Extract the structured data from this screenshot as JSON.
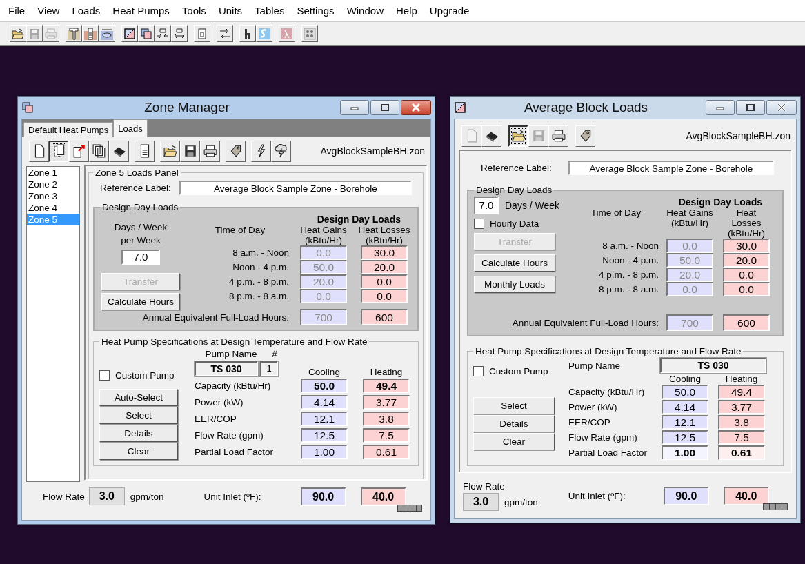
{
  "menu_bar": [
    "File",
    "View",
    "Loads",
    "Heat Pumps",
    "Tools",
    "Units",
    "Tables",
    "Settings",
    "Window",
    "Help",
    "Upgrade"
  ],
  "toolbar": [
    [
      {
        "pressed": false,
        "disabled": false
      },
      {
        "pressed": false,
        "disabled": true
      },
      {
        "pressed": false,
        "disabled": true
      }
    ],
    [
      {
        "pressed": false,
        "disabled": false
      },
      {
        "pressed": false,
        "disabled": false
      },
      {
        "pressed": false,
        "disabled": false
      }
    ],
    [
      {
        "pressed": false,
        "disabled": false
      },
      {
        "pressed": false,
        "disabled": false
      },
      {
        "pressed": false,
        "disabled": false
      },
      {
        "pressed": false,
        "disabled": false
      }
    ],
    [
      {
        "pressed": false,
        "disabled": false
      }
    ],
    [
      {
        "pressed": false,
        "disabled": false
      }
    ],
    [
      {
        "pressed": false,
        "disabled": false
      },
      {
        "pressed": false,
        "disabled": false
      }
    ],
    [
      {
        "pressed": false,
        "disabled": false
      }
    ],
    [
      {
        "pressed": false,
        "disabled": false
      }
    ]
  ],
  "zone_manager": {
    "title": "Zone Manager",
    "active": true,
    "tabs": [
      {
        "label": "Default Heat Pumps",
        "selected": false
      },
      {
        "label": "Loads",
        "selected": true
      }
    ],
    "toolbar": [
      [
        {
          "pressed": false,
          "disabled": false
        },
        {
          "pressed": true,
          "disabled": false
        },
        {
          "pressed": false,
          "disabled": false
        },
        {
          "pressed": false,
          "disabled": false
        },
        {
          "pressed": false,
          "disabled": false
        }
      ],
      [
        {
          "pressed": false,
          "disabled": false
        }
      ],
      [
        {
          "pressed": false,
          "disabled": false
        },
        {
          "pressed": false,
          "disabled": false
        },
        {
          "pressed": false,
          "disabled": false
        }
      ],
      [
        {
          "pressed": false,
          "disabled": false
        }
      ],
      [
        {
          "pressed": false,
          "disabled": false
        },
        {
          "pressed": false,
          "disabled": false
        }
      ]
    ],
    "file_name": "AvgBlockSampleBH.zon",
    "zones": [
      {
        "label": "Zone 1",
        "selected": false
      },
      {
        "label": "Zone 2",
        "selected": false
      },
      {
        "label": "Zone 3",
        "selected": false
      },
      {
        "label": "Zone 4",
        "selected": false
      },
      {
        "label": "Zone 5",
        "selected": true
      }
    ],
    "panel_title": "Zone 5 Loads Panel",
    "reference": {
      "label": "Reference Label:",
      "value": "Average Block Sample Zone - Borehole"
    },
    "design_day": {
      "group_title": "Design Day Loads",
      "days_label": "Days / Week per Week",
      "days_value": "7.0",
      "buttons": [
        {
          "label": "Transfer",
          "disabled": true
        },
        {
          "label": "Calculate Hours",
          "disabled": false
        }
      ],
      "table_title": "Design Day Loads",
      "time_header": "Time of Day",
      "columns": [
        {
          "label": "Heat Gains (kBtu/Hr)",
          "color": "#e0e0fc",
          "disabled": true
        },
        {
          "label": "Heat Losses (kBtu/Hr)",
          "color": "#fcd2d2",
          "disabled": false
        }
      ],
      "rows": [
        {
          "time": "8 a.m. - Noon",
          "values": [
            "0.0",
            "30.0"
          ]
        },
        {
          "time": "Noon - 4 p.m.",
          "values": [
            "50.0",
            "20.0"
          ]
        },
        {
          "time": "4 p.m. - 8 p.m.",
          "values": [
            "20.0",
            "0.0"
          ]
        },
        {
          "time": "8 p.m. - 8 a.m.",
          "values": [
            "0.0",
            "0.0"
          ]
        }
      ],
      "annual_label": "Annual Equivalent Full-Load Hours:",
      "annual_values": [
        "700",
        "600"
      ]
    },
    "heat_pump": {
      "group_title": "Heat Pump Specifications at Design Temperature and Flow Rate",
      "custom": {
        "label": "Custom Pump",
        "checked": false
      },
      "pump_name_header": "Pump Name",
      "count_header": "#",
      "pump_name": "TS 030",
      "count": "1",
      "buttons": [
        "Auto-Select",
        "Select",
        "Details",
        "Clear"
      ],
      "columns": [
        {
          "label": "Cooling",
          "color": "#e0e0fc"
        },
        {
          "label": "Heating",
          "color": "#fcd2d2"
        }
      ],
      "rows": [
        {
          "label": "Capacity (kBtu/Hr)",
          "values": [
            "50.0",
            "49.4"
          ],
          "bold": true,
          "pale": false
        },
        {
          "label": "Power (kW)",
          "values": [
            "4.14",
            "3.77"
          ],
          "bold": false,
          "pale": false
        },
        {
          "label": "EER/COP",
          "values": [
            "12.1",
            "3.8"
          ],
          "bold": false,
          "pale": false
        },
        {
          "label": "Flow Rate (gpm)",
          "values": [
            "12.5",
            "7.5"
          ],
          "bold": false,
          "pale": false
        },
        {
          "label": "Partial Load Factor",
          "values": [
            "1.00",
            "0.61"
          ],
          "bold": false,
          "pale": false
        }
      ]
    },
    "flow_rate": {
      "label": "Flow Rate",
      "value": "3.0",
      "unit": "gpm/ton"
    },
    "unit_inlet": {
      "label": "Unit Inlet (ºF):",
      "values": [
        "90.0",
        "40.0"
      ]
    }
  },
  "average_block_loads": {
    "title": "Average Block Loads",
    "active": false,
    "toolbar": [
      [
        {
          "pressed": false,
          "disabled": true
        },
        {
          "pressed": false,
          "disabled": false
        }
      ],
      [
        {
          "pressed": true,
          "disabled": false
        },
        {
          "pressed": false,
          "disabled": true
        },
        {
          "pressed": false,
          "disabled": false
        }
      ],
      [
        {
          "pressed": false,
          "disabled": false
        }
      ]
    ],
    "file_name": "AvgBlockSampleBH.zon",
    "reference": {
      "label": "Reference Label:",
      "value": "Average Block Sample Zone - Borehole"
    },
    "design_day": {
      "group_title": "Design Day Loads",
      "days_label": "Days / Week",
      "days_value": "7.0",
      "hourly": {
        "label": "Hourly Data",
        "checked": false
      },
      "buttons": [
        {
          "label": "Transfer",
          "disabled": true
        },
        {
          "label": "Calculate Hours",
          "disabled": false
        },
        {
          "label": "Monthly Loads",
          "disabled": false
        }
      ],
      "table_title": "Design Day Loads",
      "time_header": "Time of Day",
      "columns": [
        {
          "label": "Heat Gains (kBtu/Hr)",
          "color": "#e0e0fc",
          "disabled": true
        },
        {
          "label": "Heat Losses (kBtu/Hr)",
          "color": "#fcd2d2",
          "disabled": false
        }
      ],
      "rows": [
        {
          "time": "8 a.m. - Noon",
          "values": [
            "0.0",
            "30.0"
          ]
        },
        {
          "time": "Noon - 4 p.m.",
          "values": [
            "50.0",
            "20.0"
          ]
        },
        {
          "time": "4 p.m. - 8 p.m.",
          "values": [
            "20.0",
            "0.0"
          ]
        },
        {
          "time": "8 p.m. - 8 a.m.",
          "values": [
            "0.0",
            "0.0"
          ]
        }
      ],
      "annual_label": "Annual Equivalent Full-Load Hours:",
      "annual_values": [
        "700",
        "600"
      ]
    },
    "heat_pump": {
      "group_title": "Heat Pump Specifications at Design Temperature and Flow Rate",
      "custom": {
        "label": "Custom Pump",
        "checked": false
      },
      "pump_name_header": "Pump Name",
      "pump_name": "TS 030",
      "buttons": [
        "Select",
        "Details",
        "Clear"
      ],
      "columns": [
        {
          "label": "Cooling",
          "color": "#e0e0fc"
        },
        {
          "label": "Heating",
          "color": "#fcd2d2"
        }
      ],
      "rows": [
        {
          "label": "Capacity (kBtu/Hr)",
          "values": [
            "50.0",
            "49.4"
          ],
          "bold": false,
          "pale": false
        },
        {
          "label": "Power (kW)",
          "values": [
            "4.14",
            "3.77"
          ],
          "bold": false,
          "pale": false
        },
        {
          "label": "EER/COP",
          "values": [
            "12.1",
            "3.8"
          ],
          "bold": false,
          "pale": false
        },
        {
          "label": "Flow Rate (gpm)",
          "values": [
            "12.5",
            "7.5"
          ],
          "bold": false,
          "pale": false
        },
        {
          "label": "Partial Load Factor",
          "values": [
            "1.00",
            "0.61"
          ],
          "bold": true,
          "pale": true
        }
      ]
    },
    "flow_rate": {
      "label": "Flow Rate",
      "value": "3.0",
      "unit": "gpm/ton"
    },
    "unit_inlet": {
      "label": "Unit Inlet (ºF):",
      "values": [
        "90.0",
        "40.0"
      ]
    }
  }
}
